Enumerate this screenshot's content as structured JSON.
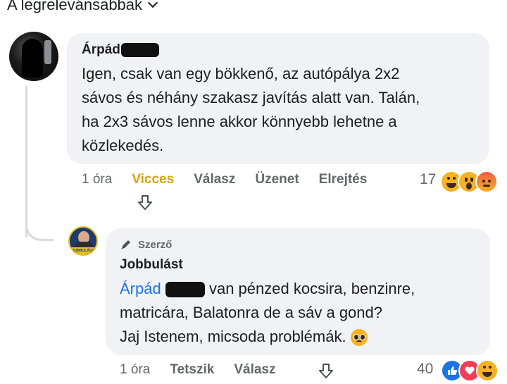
{
  "sort": {
    "label": "A legrelevánsabbak"
  },
  "comment1": {
    "author": "Árpád",
    "lines": [
      "Igen, csak van egy bökkenő, az autópálya 2x2",
      "sávos és néhány szakasz javítás alatt van. Talán,",
      "ha 2x3 sávos lenne akkor könnyebb lehetne a",
      "közlekedés."
    ],
    "actions": {
      "time": "1 óra",
      "reaction": "Vicces",
      "reply": "Válasz",
      "message": "Üzenet",
      "hide": "Elrejtés"
    },
    "reaction_count": "17",
    "reaction_icons": [
      "haha-icon",
      "wow-icon",
      "angry-icon"
    ],
    "reaction_color": "#d9a20f"
  },
  "reply1": {
    "badge": "Szerző",
    "author": "Jobbulást",
    "avatar_text": "JOBBULÁST",
    "mention": "Árpád",
    "line1_after_mention": "van pénzed kocsira, benzinre,",
    "lines": [
      "matricára, Balatonra de a sáv a gond?",
      "Jaj Istenem, micsoda problémák."
    ],
    "actions": {
      "time": "1 óra",
      "like": "Tetszik",
      "reply": "Válasz"
    },
    "reaction_count": "40",
    "reaction_icons": [
      "like-icon",
      "love-icon",
      "haha-icon"
    ],
    "mention_color": "#1b74e4"
  }
}
